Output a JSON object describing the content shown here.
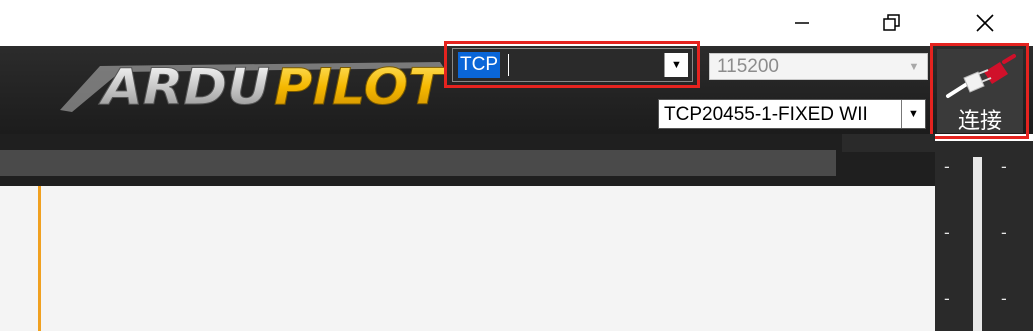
{
  "window": {
    "controls": [
      "minimize-icon",
      "restore-icon",
      "close-icon"
    ]
  },
  "header": {
    "logo_text": "ARDUPILOT",
    "connection_type": {
      "value": "TCP"
    },
    "baud_rate": {
      "value": "115200"
    },
    "link_select": {
      "value": "TCP20455-1-FIXED WII"
    },
    "connect_button": {
      "label": "连接",
      "icon": "plug-icon"
    },
    "colors": {
      "highlight": "#e5231f",
      "accent": "#f0a020",
      "selection": "#0a66d8"
    }
  },
  "gauge": {
    "ticks": [
      "-",
      "-",
      "-",
      "-",
      "-",
      "-"
    ]
  }
}
